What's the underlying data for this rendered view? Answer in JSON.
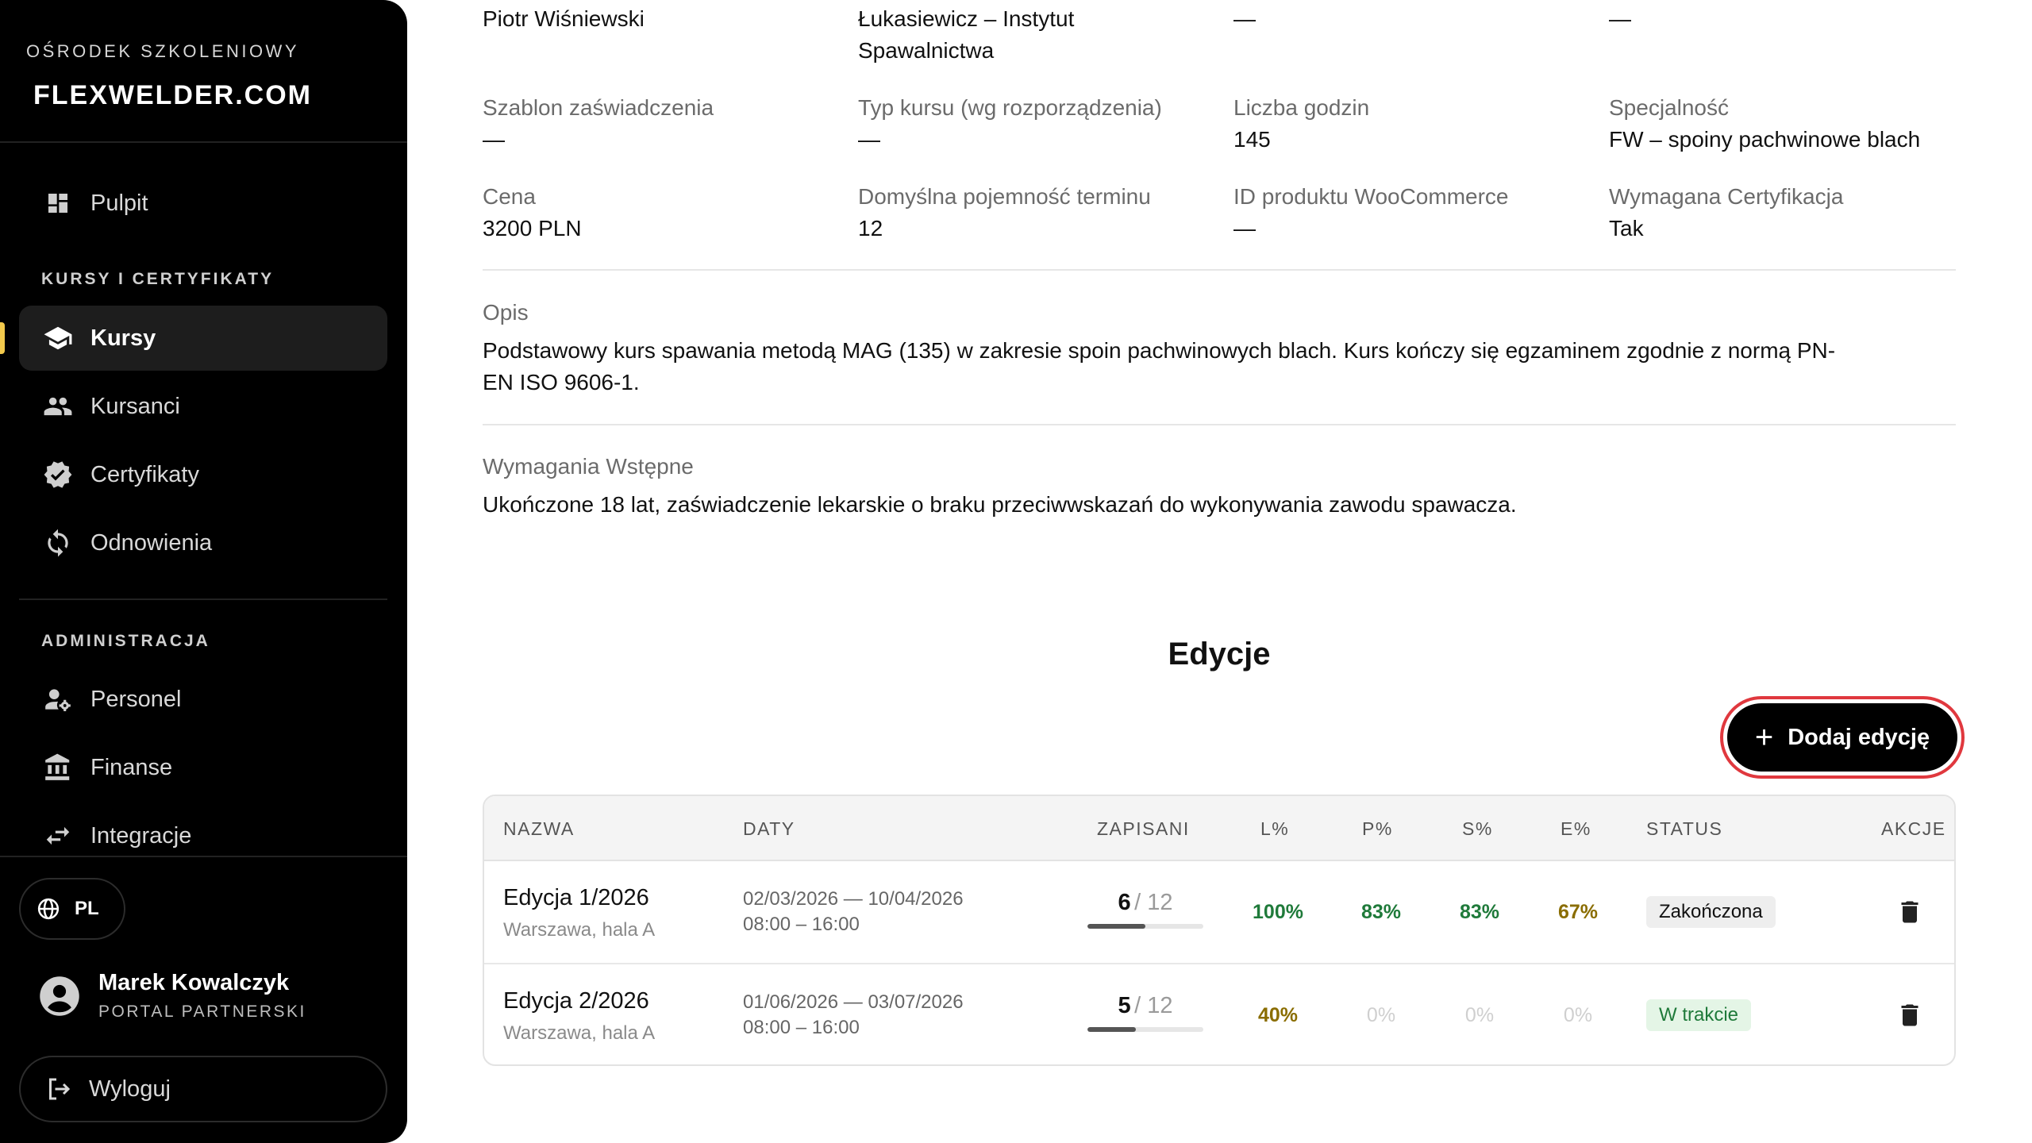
{
  "sidebar": {
    "brand_subtitle": "OŚRODEK SZKOLENIOWY",
    "brand_logo": "FLEXWELDER.COM",
    "nav_top": {
      "label": "Pulpit",
      "icon": "dashboard-icon"
    },
    "section_courses": "KURSY I CERTYFIKATY",
    "courses_items": [
      {
        "label": "Kursy",
        "icon": "graduation-cap-icon",
        "active": true
      },
      {
        "label": "Kursanci",
        "icon": "users-icon",
        "active": false
      },
      {
        "label": "Certyfikaty",
        "icon": "verified-badge-icon",
        "active": false
      },
      {
        "label": "Odnowienia",
        "icon": "refresh-icon",
        "active": false
      }
    ],
    "section_admin": "ADMINISTRACJA",
    "admin_items": [
      {
        "label": "Personel",
        "icon": "staff-settings-icon"
      },
      {
        "label": "Finanse",
        "icon": "bank-icon"
      },
      {
        "label": "Integracje",
        "icon": "swap-arrows-icon"
      }
    ],
    "language": "PL",
    "user": {
      "name": "Marek Kowalczyk",
      "role": "PORTAL PARTNERSKI"
    },
    "logout_label": "Wyloguj",
    "active_marker_color": "#f2c94c"
  },
  "details": {
    "row0": {
      "col1": "Piotr Wiśniewski",
      "col2_line1": "Łukasiewicz – Instytut",
      "col2_line2": "Spawalnictwa",
      "col3": "—",
      "col4": "—"
    },
    "row1": [
      {
        "label": "Szablon zaświadczenia",
        "value": "—"
      },
      {
        "label": "Typ kursu (wg rozporządzenia)",
        "value": "—"
      },
      {
        "label": "Liczba godzin",
        "value": "145"
      },
      {
        "label": "Specjalność",
        "value": "FW – spoiny pachwinowe blach"
      }
    ],
    "row2": [
      {
        "label": "Cena",
        "value": "3200 PLN"
      },
      {
        "label": "Domyślna pojemność terminu",
        "value": "12"
      },
      {
        "label": "ID produktu WooCommerce",
        "value": "—"
      },
      {
        "label": "Wymagana Certyfikacja",
        "value": "Tak"
      }
    ],
    "description_label": "Opis",
    "description_line1": "Podstawowy kurs spawania metodą MAG (135) w zakresie spoin pachwinowych blach. Kurs kończy się egzaminem zgodnie z normą PN-",
    "description_line2": "EN ISO 9606-1.",
    "prereq_label": "Wymagania Wstępne",
    "prereq_text": "Ukończone 18 lat, zaświadczenie lekarskie o braku przeciwwskazań do wykonywania zawodu spawacza."
  },
  "editions": {
    "title": "Edycje",
    "add_label": "Dodaj edycję",
    "add_highlight_color": "#e0383e",
    "columns": [
      "NAZWA",
      "DATY",
      "ZAPISANI",
      "L%",
      "P%",
      "S%",
      "E%",
      "STATUS",
      "AKCJE"
    ],
    "rows": [
      {
        "name": "Edycja 1/2026",
        "location": "Warszawa, hala A",
        "dates": "02/03/2026 — 10/04/2026",
        "hours": "08:00 – 16:00",
        "enrolled": "6",
        "capacity": "/ 12",
        "enrolled_fraction": 0.5,
        "l": "100%",
        "p": "83%",
        "s": "83%",
        "e": "67%",
        "status": "Zakończona"
      },
      {
        "name": "Edycja 2/2026",
        "location": "Warszawa, hala A",
        "dates": "01/06/2026 — 03/07/2026",
        "hours": "08:00 – 16:00",
        "enrolled": "5",
        "capacity": "/ 12",
        "enrolled_fraction": 0.4167,
        "l": "40%",
        "p": "0%",
        "s": "0%",
        "e": "0%",
        "status": "W trakcie"
      }
    ]
  }
}
